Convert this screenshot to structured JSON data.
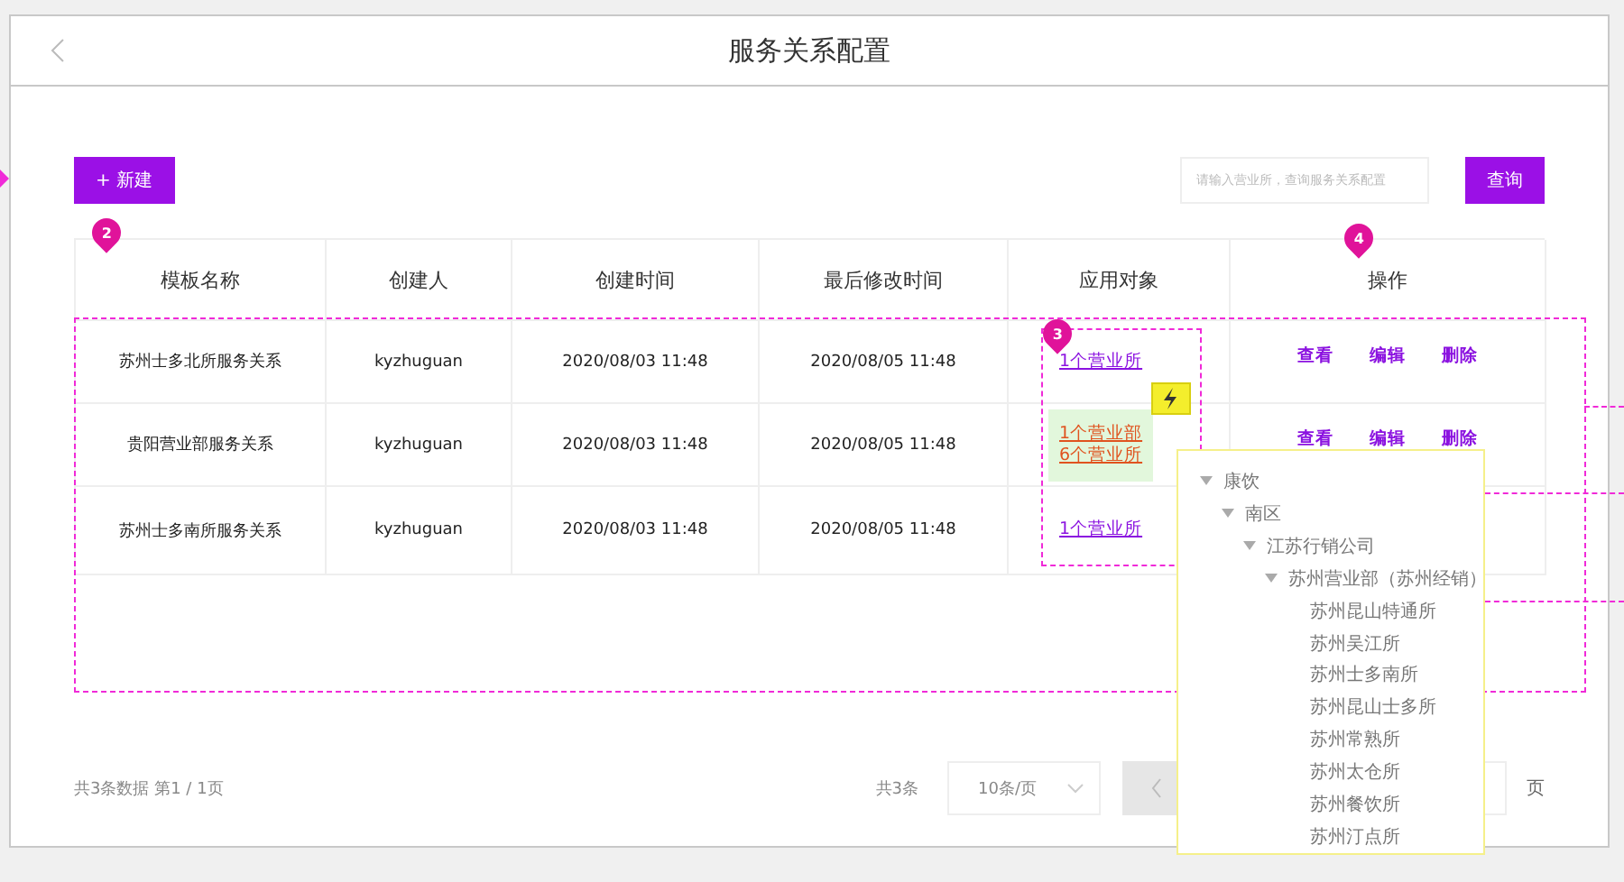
{
  "header": {
    "title": "服务关系配置"
  },
  "toolbar": {
    "new_button": "+ 新建",
    "search": {
      "placeholder": "请输入营业所，查询服务关系配置"
    },
    "query_button": "查询"
  },
  "table": {
    "columns": [
      "模板名称",
      "创建人",
      "创建时间",
      "最后修改时间",
      "应用对象",
      "操作"
    ],
    "rows": [
      {
        "name": "苏州士多北所服务关系",
        "creator": "kyzhuguan",
        "created": "2020/08/03 11:48",
        "modified": "2020/08/05 11:48",
        "targets": [
          "1个营业所"
        ],
        "highlighted": false,
        "actions": [
          "查看",
          "编辑",
          "删除"
        ]
      },
      {
        "name": "贵阳营业部服务关系",
        "creator": "kyzhuguan",
        "created": "2020/08/03 11:48",
        "modified": "2020/08/05 11:48",
        "targets": [
          "1个营业部",
          "6个营业所"
        ],
        "highlighted": true,
        "actions": [
          "查看",
          "编辑",
          "删除"
        ]
      },
      {
        "name": "苏州士多南所服务关系",
        "creator": "kyzhuguan",
        "created": "2020/08/03 11:48",
        "modified": "2020/08/05 11:48",
        "targets": [
          "1个营业所"
        ],
        "highlighted": false,
        "actions": []
      }
    ]
  },
  "annotations": [
    "2",
    "3",
    "4"
  ],
  "footer": {
    "summary": "共3条数据 第1 / 1页",
    "total": "共3条",
    "page_size": "10条/页",
    "page_unit": "页"
  },
  "tree": [
    {
      "label": "康饮",
      "expanded": true,
      "children": [
        {
          "label": "南区",
          "expanded": true,
          "children": [
            {
              "label": "江苏行销公司",
              "expanded": true,
              "children": [
                {
                  "label": "苏州营业部（苏州经销）",
                  "expanded": true,
                  "children": [
                    {
                      "label": "苏州昆山特通所"
                    },
                    {
                      "label": "苏州吴江所"
                    },
                    {
                      "label": "苏州士多南所"
                    },
                    {
                      "label": "苏州昆山士多所"
                    },
                    {
                      "label": "苏州常熟所"
                    },
                    {
                      "label": "苏州太仓所"
                    },
                    {
                      "label": "苏州餐饮所"
                    },
                    {
                      "label": "苏州汀点所"
                    }
                  ]
                }
              ]
            }
          ]
        }
      ]
    }
  ]
}
